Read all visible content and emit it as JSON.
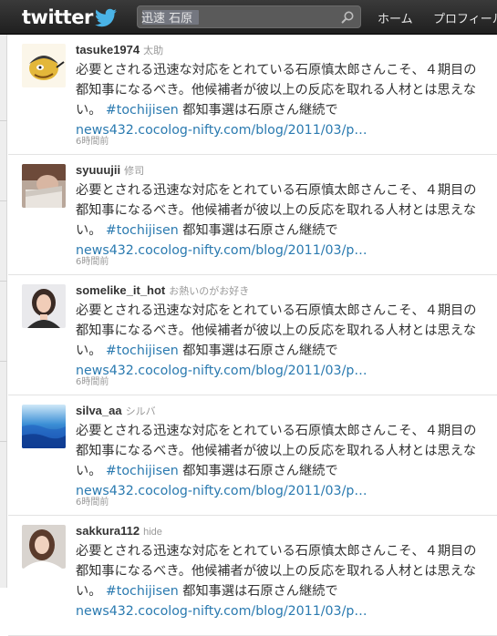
{
  "header": {
    "logo_text": "twitter",
    "search": {
      "value": "迅速 石原",
      "placeholder": ""
    },
    "nav": [
      "ホーム",
      "プロフィール"
    ]
  },
  "tweets": [
    {
      "username": "tasuke1974",
      "realname": "太助",
      "text": "必要とされる迅速な対応をとれている石原慎太郎さんこそ、４期目の都知事になるべき。他候補者が彼以上の反応を取れる人材とは思えない。",
      "hashtag": "#tochijisen",
      "text_after": "都知事選は石原さん継続で",
      "link": "news432.cocolog-nifty.com/blog/2011/03/p…",
      "time": "6時間前",
      "avatar": "cartoon-character"
    },
    {
      "username": "syuuujii",
      "realname": "修司",
      "text": "必要とされる迅速な対応をとれている石原慎太郎さんこそ、４期目の都知事になるべき。他候補者が彼以上の反応を取れる人材とは思えない。",
      "hashtag": "#tochijisen",
      "text_after": "都知事選は石原さん継続で",
      "link": "news432.cocolog-nifty.com/blog/2011/03/p…",
      "time": "6時間前",
      "avatar": "photo-person-reading"
    },
    {
      "username": "somelike_it_hot",
      "realname": "お熱いのがお好き",
      "text": "必要とされる迅速な対応をとれている石原慎太郎さんこそ、４期目の都知事になるべき。他候補者が彼以上の反応を取れる人材とは思えない。",
      "hashtag": "#tochijisen",
      "text_after": "都知事選は石原さん継続で",
      "link": "news432.cocolog-nifty.com/blog/2011/03/p…",
      "time": "6時間前",
      "avatar": "photo-woman"
    },
    {
      "username": "silva_aa",
      "realname": "シルバ",
      "text": "必要とされる迅速な対応をとれている石原慎太郎さんこそ、４期目の都知事になるべき。他候補者が彼以上の反応を取れる人材とは思えない。",
      "hashtag": "#tochijisen",
      "text_after": "都知事選は石原さん継続で",
      "link": "news432.cocolog-nifty.com/blog/2011/03/p…",
      "time": "6時間前",
      "avatar": "blue-gradient"
    },
    {
      "username": "sakkura112",
      "realname": "hide",
      "text": "必要とされる迅速な対応をとれている石原慎太郎さんこそ、４期目の都知事になるべき。他候補者が彼以上の反応を取れる人材とは思えない。",
      "hashtag": "#tochijisen",
      "text_after": "都知事選は石原さん継続で",
      "link": "news432.cocolog-nifty.com/blog/2011/03/p…",
      "time": "",
      "avatar": "photo-woman-2"
    }
  ],
  "colors": {
    "link": "#2a7ab0",
    "topbar": "#2b2b2b",
    "muted": "#999999"
  }
}
